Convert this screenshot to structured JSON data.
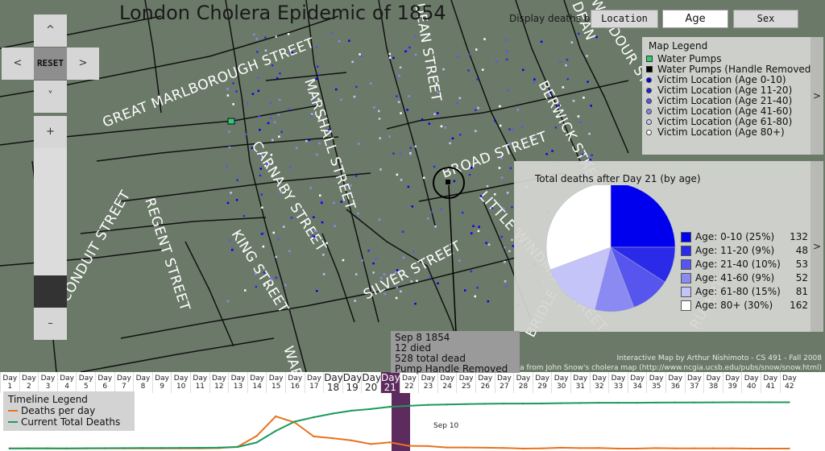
{
  "title": "London Cholera Epidemic of 1854",
  "display": {
    "label": "Display deaths by:",
    "buttons": [
      {
        "label": "Location",
        "active": false
      },
      {
        "label": "Age",
        "active": true
      },
      {
        "label": "Sex",
        "active": false
      }
    ]
  },
  "nav": {
    "up": "^",
    "left": "<",
    "reset": "RESET",
    "right": ">",
    "down": "˅",
    "zoom_in": "+",
    "zoom_out": "–"
  },
  "streets": [
    "GREAT MARLBOROUGH STREET",
    "MARSHALL STREET",
    "CARNABY STREET",
    "REGENT STREET",
    "CONDUIT STREET",
    "KING STREET",
    "SILVER STREET",
    "BROAD STREET",
    "BERWICK STREET",
    "WARDOUR STREET",
    "LITTLE WINDMILL STREET",
    "DEAN STREET",
    "RUPERT",
    "WAR",
    "DEAN",
    "BRIDLE"
  ],
  "legend": {
    "title": "Map Legend",
    "items": [
      {
        "label": "Water Pumps",
        "color": "#2ecc71",
        "kind": "square"
      },
      {
        "label": "Water Pumps (Handle Removed)",
        "color": "#000000",
        "kind": "square"
      },
      {
        "label": "Victim Location (Age 0-10)",
        "color": "#0000ee",
        "kind": "dot"
      },
      {
        "label": "Victim Location (Age 11-20)",
        "color": "#2222dd",
        "kind": "dot"
      },
      {
        "label": "Victim Location (Age 21-40)",
        "color": "#5555ee",
        "kind": "dot"
      },
      {
        "label": "Victim Location (Age 41-60)",
        "color": "#8888f0",
        "kind": "dot"
      },
      {
        "label": "Victim Location (Age 61-80)",
        "color": "#c8c8f8",
        "kind": "dot"
      },
      {
        "label": "Victim Location (Age 80+)",
        "color": "#ffffff",
        "kind": "dot"
      }
    ],
    "tab": ">"
  },
  "pie_tab": ">",
  "tooltip": {
    "lines": [
      "Sep 8 1854",
      "12 died",
      "528 total dead",
      "Pump Handle Removed"
    ]
  },
  "credits": [
    "Interactive Map by Arthur Nishimoto - CS 491 - Fall 2008",
    "GIA data from John Snow's cholera map (http://www.ncgia.ucsb.edu/pubs/snow/snow.html)"
  ],
  "timeline": {
    "legend_title": "Timeline Legend",
    "series_labels": [
      "Deaths per day",
      "Current Total Deaths"
    ],
    "days": [
      "Day 1",
      "Day 2",
      "Day 3",
      "Day 4",
      "Day 5",
      "Day 6",
      "Day 7",
      "Day 8",
      "Day 9",
      "Day 10",
      "Day 11",
      "Day 12",
      "Day 13",
      "Day 14",
      "Day 15",
      "Day 16",
      "Day 17",
      "Day 18",
      "Day 19",
      "Day 20",
      "Day 21",
      "Day 22",
      "Day 23",
      "Day 24",
      "Day 25",
      "Day 26",
      "Day 27",
      "Day 28",
      "Day 29",
      "Day 30",
      "Day 31",
      "Day 32",
      "Day 33",
      "Day 34",
      "Day 35",
      "Day 36",
      "Day 37",
      "Day 38",
      "Day 39",
      "Day 40",
      "Day 41",
      "Day 42"
    ],
    "selected_day": 21,
    "date_annotation": "Sep 10"
  },
  "chart_data": [
    {
      "type": "pie",
      "title": "Total deaths after Day 21 (by age)",
      "categories": [
        "Age: 0-10 (25%)",
        "Age: 11-20 (9%)",
        "Age: 21-40 (10%)",
        "Age: 41-60 (9%)",
        "Age: 61-80 (15%)",
        "Age: 80+ (30%)"
      ],
      "values": [
        132,
        48,
        53,
        52,
        81,
        162
      ],
      "colors": [
        "#0000ee",
        "#2a2ae8",
        "#5656ee",
        "#8a8af2",
        "#c4c4f8",
        "#ffffff"
      ]
    },
    {
      "type": "line",
      "x": [
        1,
        2,
        3,
        4,
        5,
        6,
        7,
        8,
        9,
        10,
        11,
        12,
        13,
        14,
        15,
        16,
        17,
        18,
        19,
        20,
        21,
        22,
        23,
        24,
        25,
        26,
        27,
        28,
        29,
        30,
        31,
        32,
        33,
        34,
        35,
        36,
        37,
        38,
        39,
        40,
        41,
        42
      ],
      "series": [
        {
          "name": "Deaths per day",
          "color": "#e8731f",
          "values": [
            1,
            1,
            1,
            0,
            1,
            1,
            1,
            1,
            1,
            1,
            1,
            2,
            8,
            56,
            143,
            116,
            54,
            46,
            36,
            20,
            28,
            12,
            11,
            5,
            5,
            4,
            3,
            0,
            1,
            4,
            2,
            3,
            0,
            0,
            2,
            1,
            1,
            1,
            1,
            0,
            0,
            0
          ]
        },
        {
          "name": "Current Total Deaths",
          "color": "#1e9a5a",
          "values": [
            1,
            2,
            3,
            3,
            4,
            5,
            6,
            7,
            8,
            9,
            10,
            12,
            20,
            76,
            219,
            335,
            389,
            435,
            471,
            491,
            519,
            531,
            542,
            547,
            552,
            556,
            559,
            559,
            560,
            564,
            566,
            569,
            569,
            569,
            571,
            572,
            573,
            574,
            575,
            575,
            575,
            575
          ]
        }
      ]
    }
  ]
}
